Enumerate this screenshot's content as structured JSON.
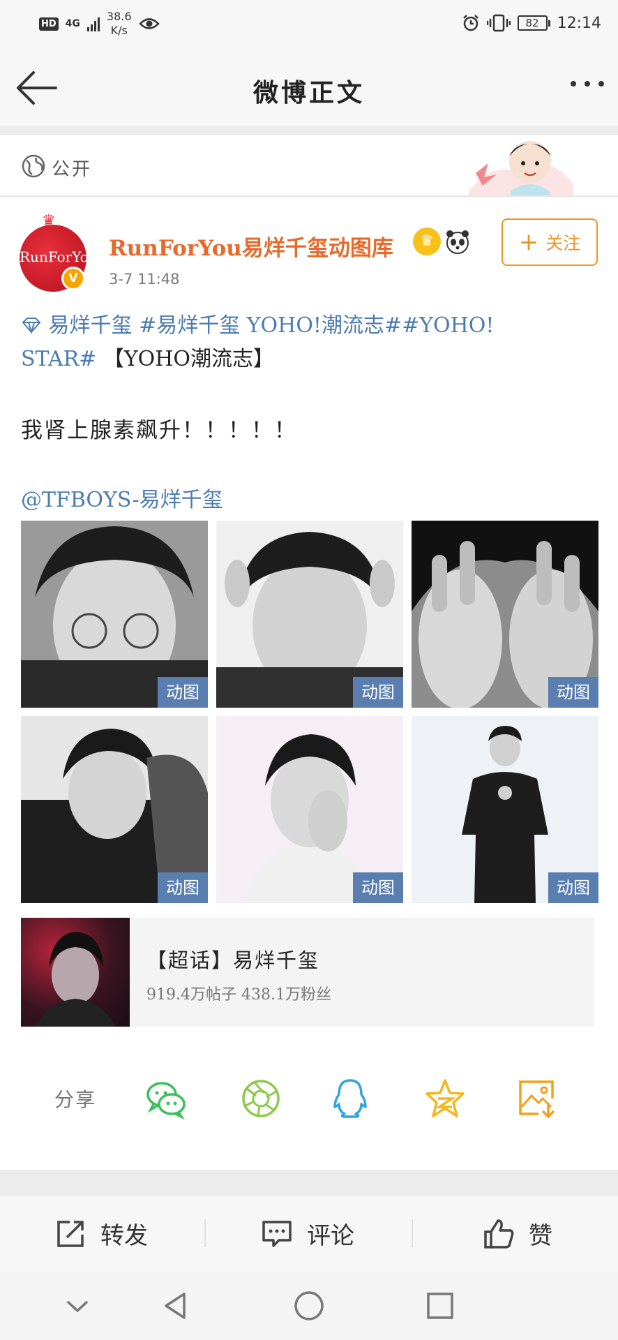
{
  "status_bar": {
    "hd": "HD",
    "network": "4G",
    "speed_value": "38.6",
    "speed_unit": "K/s",
    "battery": "82",
    "time": "12:14"
  },
  "nav": {
    "title": "微博正文"
  },
  "visibility": {
    "label": "公开"
  },
  "post": {
    "username": "RunForYou易烊千玺动图库",
    "verified_mark": "V",
    "avatar_logo": "RunForYou",
    "time": "3-7 11:48",
    "follow_label": "关注",
    "line1": "易烊千玺 #易烊千玺 YOHO!潮流志##YOHO!",
    "line2_link": "STAR#",
    "line2_text": " 【YOHO潮流志】",
    "line3": "我肾上腺素飙升！！！！！",
    "mention": "@TFBOYS-易烊千玺",
    "gif_badge": "动图"
  },
  "topic": {
    "title": "【超话】易烊千玺",
    "stats": "919.4万帖子 438.1万粉丝"
  },
  "share": {
    "label": "分享"
  },
  "actions": {
    "repost": "转发",
    "comment": "评论",
    "like": "赞"
  },
  "colors": {
    "accent_orange": "#e8692a",
    "link_blue": "#4a7bb3",
    "follow_orange": "#f09325",
    "gif_badge": "#5b7eb0"
  }
}
